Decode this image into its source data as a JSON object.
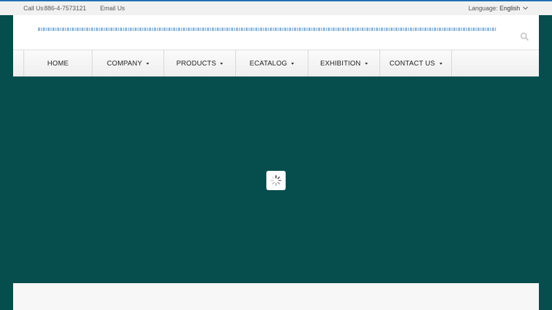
{
  "topbar": {
    "call_label": "Call Us",
    "phone": "886-4-7573121",
    "email_label": "Email Us",
    "language_label": "Language:",
    "language_value": "English"
  },
  "nav": {
    "items": [
      {
        "label": "HOME",
        "has_dropdown": false
      },
      {
        "label": "COMPANY",
        "has_dropdown": true
      },
      {
        "label": "PRODUCTS",
        "has_dropdown": true
      },
      {
        "label": "ECATALOG",
        "has_dropdown": true
      },
      {
        "label": "EXHIBITION",
        "has_dropdown": true
      },
      {
        "label": "CONTACT US",
        "has_dropdown": true
      }
    ]
  },
  "icons": {
    "search": "search-icon",
    "loader": "loading-spinner-icon",
    "language": "chevron-down-icon",
    "dropdown": "caret-down-icon"
  },
  "colors": {
    "accent": "#1f6fb4",
    "background": "#064d4d",
    "nav_bg": "#f3f3f3",
    "text": "#222222"
  }
}
